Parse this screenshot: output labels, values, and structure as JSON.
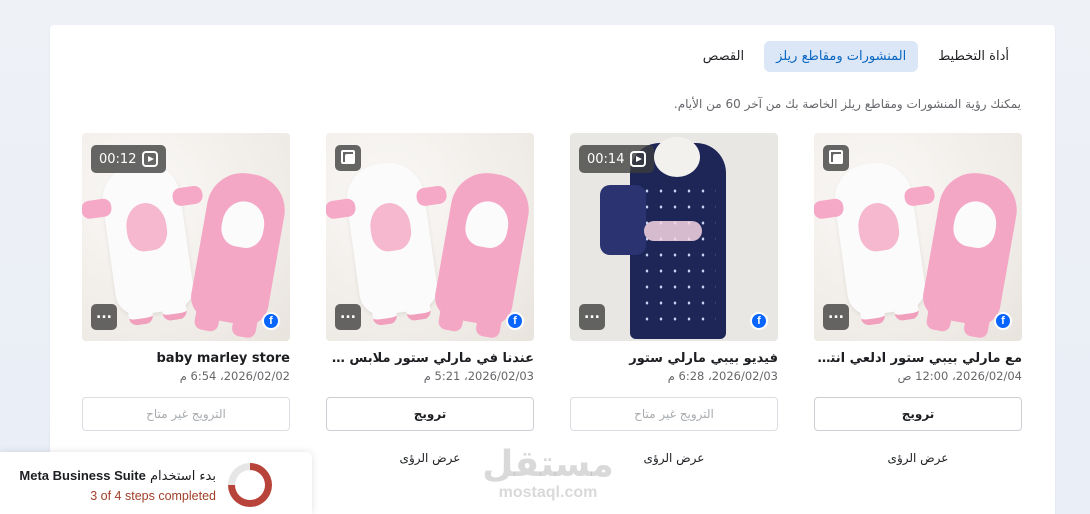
{
  "tabs": [
    {
      "label": "أداة التخطيط",
      "active": false
    },
    {
      "label": "المنشورات ومقاطع ريلز",
      "active": true
    },
    {
      "label": "القصص",
      "active": false
    }
  ],
  "subtitle": "يمكنك رؤية المنشورات ومقاطع ريلز الخاصة بك من آخر 60 من الأيام.",
  "cards": [
    {
      "title": "baby marley store",
      "date": "2026/02/02، 6:54 م",
      "boost_label": "الترويج غير متاح",
      "boost_enabled": false,
      "insights_label": "",
      "media_type": "reel",
      "duration": "00:12",
      "platform_icon": "facebook-icon"
    },
    {
      "title": "عندنا في مارلي ستور ملابس طفلك...",
      "date": "2026/02/03، 5:21 م",
      "boost_label": "ترويج",
      "boost_enabled": true,
      "insights_label": "عرض الرؤى",
      "media_type": "album",
      "platform_icon": "facebook-icon"
    },
    {
      "title": "فيديو بيبي مارلي ستور",
      "date": "2026/02/03، 6:28 م",
      "boost_label": "الترويج غير متاح",
      "boost_enabled": false,
      "insights_label": "عرض الرؤى",
      "media_type": "reel",
      "duration": "00:14",
      "platform_icon": "facebook-icon"
    },
    {
      "title": "مع مارلي بيبي ستور ادلعي انتي و ...",
      "date": "2026/02/04، 12:00 ص",
      "boost_label": "ترويج",
      "boost_enabled": true,
      "insights_label": "عرض الرؤى",
      "media_type": "album",
      "platform_icon": "facebook-icon"
    }
  ],
  "more_label": "...",
  "fb_glyph": "f",
  "watermark": {
    "arabic": "مستقل",
    "latin": "mostaql.com"
  },
  "setup": {
    "prefix": "بدء استخدام",
    "product": "Meta Business Suite",
    "progress_text": "3 of 4 steps completed",
    "progress_fraction": 0.75,
    "ring_color": "#b8433a"
  }
}
